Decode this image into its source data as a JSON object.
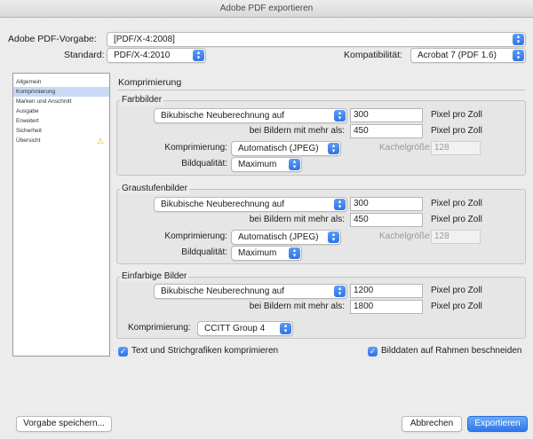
{
  "window": {
    "title": "Adobe PDF exportieren"
  },
  "header": {
    "preset_label": "Adobe PDF-Vorgabe:",
    "preset_value": "[PDF/X-4:2008]",
    "standard_label": "Standard:",
    "standard_value": "PDF/X-4:2010",
    "compat_label": "Kompatibilität:",
    "compat_value": "Acrobat 7 (PDF 1.6)"
  },
  "sidebar": {
    "items": [
      {
        "label": "Allgemein"
      },
      {
        "label": "Komprimierung"
      },
      {
        "label": "Marken und Anschnitt"
      },
      {
        "label": "Ausgabe"
      },
      {
        "label": "Erweitert"
      },
      {
        "label": "Sicherheit"
      },
      {
        "label": "Übersicht"
      }
    ],
    "selected": "Komprimierung",
    "warning_icon": "warning-triangle-icon"
  },
  "panel": {
    "title": "Komprimierung"
  },
  "color_images": {
    "title": "Farbbilder",
    "resample_value": "Bikubische Neuberechnung auf",
    "resolution": "300",
    "resolution_unit": "Pixel pro Zoll",
    "threshold_label": "bei Bildern mit mehr als:",
    "threshold": "450",
    "threshold_unit": "Pixel pro Zoll",
    "compression_label": "Komprimierung:",
    "compression_value": "Automatisch (JPEG)",
    "tile_label": "Kachelgröße:",
    "tile_value": "128",
    "quality_label": "Bildqualität:",
    "quality_value": "Maximum"
  },
  "gray_images": {
    "title": "Graustufenbilder",
    "resample_value": "Bikubische Neuberechnung auf",
    "resolution": "300",
    "resolution_unit": "Pixel pro Zoll",
    "threshold_label": "bei Bildern mit mehr als:",
    "threshold": "450",
    "threshold_unit": "Pixel pro Zoll",
    "compression_label": "Komprimierung:",
    "compression_value": "Automatisch (JPEG)",
    "tile_label": "Kachelgröße:",
    "tile_value": "128",
    "quality_label": "Bildqualität:",
    "quality_value": "Maximum"
  },
  "mono_images": {
    "title": "Einfarbige Bilder",
    "resample_value": "Bikubische Neuberechnung auf",
    "resolution": "1200",
    "resolution_unit": "Pixel pro Zoll",
    "threshold_label": "bei Bildern mit mehr als:",
    "threshold": "1800",
    "threshold_unit": "Pixel pro Zoll",
    "compression_label": "Komprimierung:",
    "compression_value": "CCITT Group 4"
  },
  "options": {
    "compress_text": "Text und Strichgrafiken komprimieren",
    "compress_text_checked": true,
    "crop_images": "Bilddaten auf Rahmen beschneiden",
    "crop_images_checked": true
  },
  "footer": {
    "save_preset": "Vorgabe speichern...",
    "cancel": "Abbrechen",
    "export": "Exportieren"
  },
  "colors": {
    "accent": "#2f74e6",
    "selection": "#c7d9f5",
    "warning": "#e0b400"
  }
}
